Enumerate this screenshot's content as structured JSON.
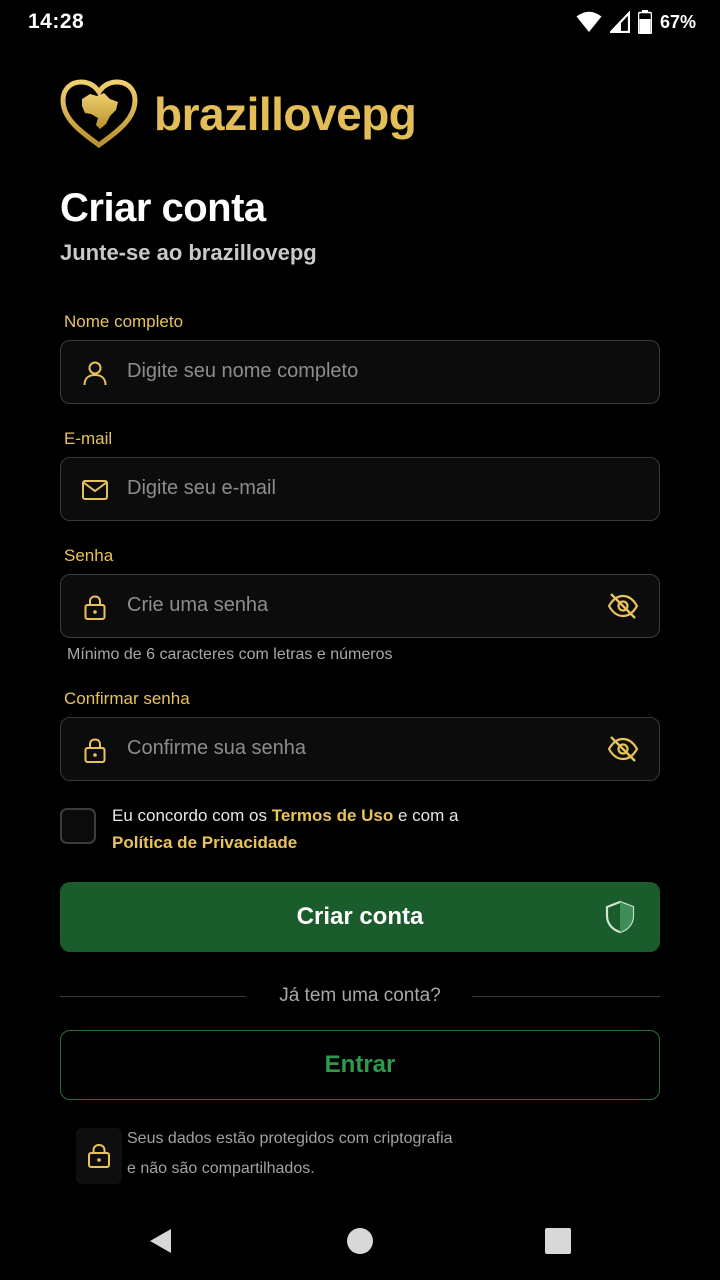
{
  "status": {
    "time": "14:28",
    "battery": "67%"
  },
  "brand": {
    "name": "brazillovepg",
    "logo_icon": "heart-brazil-map-icon",
    "accent_color": "#e2bd58"
  },
  "header": {
    "title": "Criar conta",
    "subtitle": "Junte-se ao brazillovepg"
  },
  "form": {
    "name": {
      "label": "Nome completo",
      "placeholder": "Digite seu nome completo",
      "value": "",
      "icon": "user-icon"
    },
    "email": {
      "label": "E-mail",
      "placeholder": "Digite seu e-mail",
      "value": "",
      "icon": "mail-icon"
    },
    "password": {
      "label": "Senha",
      "placeholder": "Crie uma senha",
      "value": "",
      "icon": "lock-icon",
      "hint": "Mínimo de 6 caracteres com letras e números"
    },
    "confirm": {
      "label": "Confirmar senha",
      "placeholder": "Confirme sua senha",
      "value": "",
      "icon": "lock-icon"
    }
  },
  "terms": {
    "prefix": "Eu concordo com os ",
    "terms_link": "Termos de Uso",
    "middle": " e com a",
    "privacy_link": "Política de Privacidade",
    "checked": false
  },
  "actions": {
    "create_label": "Criar conta",
    "divider_text": "Já tem uma conta?",
    "login_label": "Entrar",
    "primary_color": "#1a5c2b"
  },
  "security": {
    "line1": "Seus dados estão protegidos com criptografia",
    "line2": "e não são compartilhados."
  }
}
